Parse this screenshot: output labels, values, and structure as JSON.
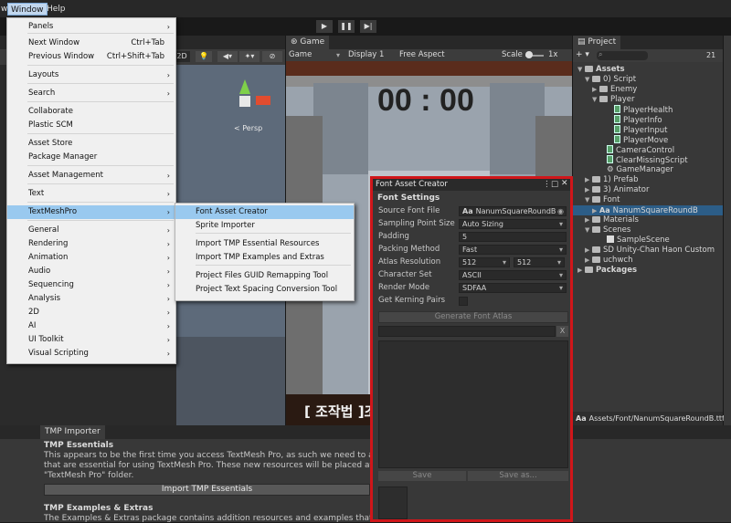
{
  "menubar": {
    "items": [
      "Window",
      "Help"
    ],
    "prefix": "w"
  },
  "window_menu": {
    "items": [
      {
        "label": "Panels",
        "submenu": true
      },
      {
        "label": "Next Window",
        "shortcut": "Ctrl+Tab"
      },
      {
        "label": "Previous Window",
        "shortcut": "Ctrl+Shift+Tab"
      },
      {
        "label": "Layouts",
        "submenu": true
      },
      {
        "label": "Search",
        "submenu": true
      },
      {
        "label": "Collaborate"
      },
      {
        "label": "Plastic SCM"
      },
      {
        "label": "Asset Store"
      },
      {
        "label": "Package Manager"
      },
      {
        "label": "Asset Management",
        "submenu": true
      },
      {
        "label": "Text",
        "submenu": true
      },
      {
        "label": "TextMeshPro",
        "submenu": true
      },
      {
        "label": "General",
        "submenu": true
      },
      {
        "label": "Rendering",
        "submenu": true
      },
      {
        "label": "Animation",
        "submenu": true
      },
      {
        "label": "Audio",
        "submenu": true
      },
      {
        "label": "Sequencing",
        "submenu": true
      },
      {
        "label": "Analysis",
        "submenu": true
      },
      {
        "label": "2D",
        "submenu": true
      },
      {
        "label": "AI",
        "submenu": true
      },
      {
        "label": "UI Toolkit",
        "submenu": true
      },
      {
        "label": "Visual Scripting",
        "submenu": true
      }
    ]
  },
  "tmp_submenu": {
    "items": [
      "Font Asset Creator",
      "Sprite Importer",
      "Import TMP Essential Resources",
      "Import TMP Examples and Extras",
      "Project Files GUID Remapping Tool",
      "Project Text Spacing Conversion Tool"
    ]
  },
  "game_view": {
    "tab": "Game",
    "mode": "Game",
    "display": "Display 1",
    "aspect": "Free Aspect",
    "scale_label": "Scale",
    "scale_value": "1x",
    "timer": "00 : 00",
    "bottom_text": "[ 조작법 ]조"
  },
  "scene_view": {
    "twod": "2D",
    "persp": "< Persp"
  },
  "project": {
    "tab": "Project",
    "count": "21",
    "tree": [
      {
        "label": "Assets",
        "indent": 0,
        "icon": "folder",
        "bold": true,
        "exp": "▼"
      },
      {
        "label": "0) Script",
        "indent": 1,
        "icon": "folder",
        "exp": "▼"
      },
      {
        "label": "Enemy",
        "indent": 2,
        "icon": "folder",
        "exp": "▶"
      },
      {
        "label": "Player",
        "indent": 2,
        "icon": "folder",
        "exp": "▼"
      },
      {
        "label": "PlayerHealth",
        "indent": 4,
        "icon": "script"
      },
      {
        "label": "PlayerInfo",
        "indent": 4,
        "icon": "script"
      },
      {
        "label": "PlayerInput",
        "indent": 4,
        "icon": "script"
      },
      {
        "label": "PlayerMove",
        "indent": 4,
        "icon": "script"
      },
      {
        "label": "CameraControl",
        "indent": 3,
        "icon": "script"
      },
      {
        "label": "ClearMissingScript",
        "indent": 3,
        "icon": "script"
      },
      {
        "label": "GameManager",
        "indent": 3,
        "icon": "gear"
      },
      {
        "label": "1) Prefab",
        "indent": 1,
        "icon": "folder",
        "exp": "▶"
      },
      {
        "label": "3) Animator",
        "indent": 1,
        "icon": "folder",
        "exp": "▶"
      },
      {
        "label": "Font",
        "indent": 1,
        "icon": "folder",
        "exp": "▼"
      },
      {
        "label": "NanumSquareRoundB",
        "indent": 2,
        "icon": "aa",
        "exp": "▶",
        "selected": true
      },
      {
        "label": "Materials",
        "indent": 1,
        "icon": "folder",
        "exp": "▶"
      },
      {
        "label": "Scenes",
        "indent": 1,
        "icon": "folder",
        "exp": "▼"
      },
      {
        "label": "SampleScene",
        "indent": 3,
        "icon": "scene"
      },
      {
        "label": "SD Unity-Chan Haon Custom",
        "indent": 1,
        "icon": "folder",
        "exp": "▶"
      },
      {
        "label": "uchwch",
        "indent": 1,
        "icon": "folder",
        "exp": "▶"
      },
      {
        "label": "Packages",
        "indent": 0,
        "icon": "folder",
        "bold": true,
        "exp": "▶"
      }
    ],
    "path": "Assets/Font/NanumSquareRoundB.ttf"
  },
  "font_asset_creator": {
    "title": "Font Asset Creator",
    "section": "Font Settings",
    "fields": [
      {
        "label": "Source Font File",
        "value": "NanumSquareRoundB",
        "kind": "object"
      },
      {
        "label": "Sampling Point Size",
        "value": "Auto Sizing",
        "kind": "dropdown"
      },
      {
        "label": "Padding",
        "value": "5",
        "kind": "text"
      },
      {
        "label": "Packing Method",
        "value": "Fast",
        "kind": "dropdown"
      },
      {
        "label": "Atlas Resolution",
        "value": "512",
        "value2": "512",
        "kind": "double"
      },
      {
        "label": "Character Set",
        "value": "ASCII",
        "kind": "dropdown"
      },
      {
        "label": "Render Mode",
        "value": "SDFAA",
        "kind": "dropdown"
      },
      {
        "label": "Get Kerning Pairs",
        "value": "",
        "kind": "checkbox"
      }
    ],
    "generate_label": "Generate Font Atlas",
    "clear_label": "X",
    "save_label": "Save",
    "save_as_label": "Save as..."
  },
  "tmp_importer": {
    "tab": "TMP Importer",
    "essentials_title": "TMP Essentials",
    "essentials_text1": "This appears to be the first time you access TextMesh Pro, as such we need to add resources",
    "essentials_text2": "that are essential for using TextMesh Pro. These new resources will be placed at the root of y",
    "essentials_text3": "\"TextMesh Pro\" folder.",
    "import_essentials": "Import TMP Essentials",
    "examples_title": "TMP Examples & Extras",
    "examples_text": "The Examples & Extras package contains addition resources and examples that will make disc"
  },
  "colors": {
    "highlight": "#99c9ef",
    "frame": "#d0161a"
  }
}
